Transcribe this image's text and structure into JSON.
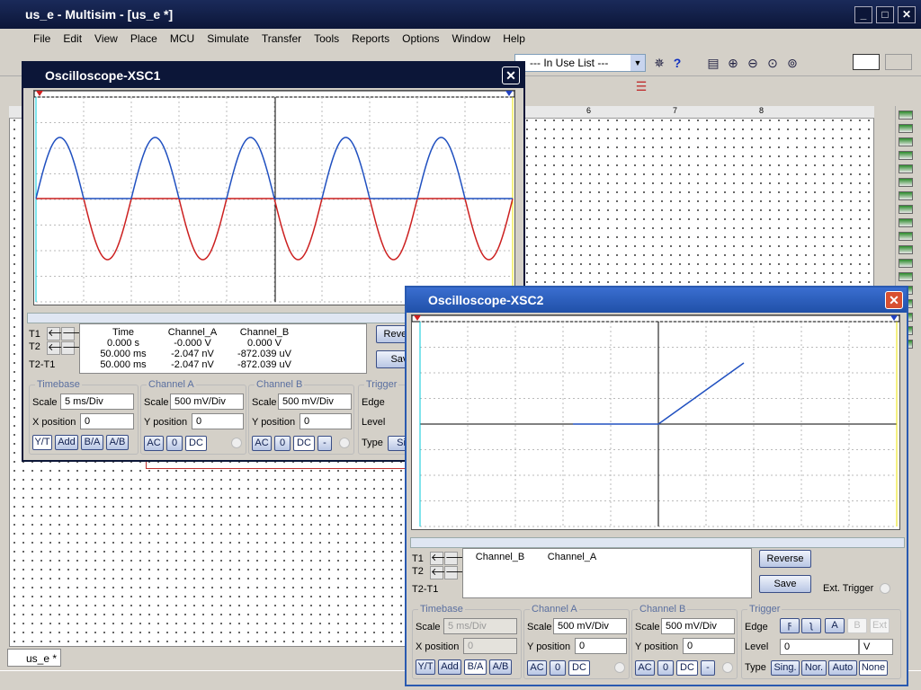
{
  "app": {
    "title": "us_e - Multisim - [us_e *]"
  },
  "menu": [
    "File",
    "Edit",
    "View",
    "Place",
    "MCU",
    "Simulate",
    "Transfer",
    "Tools",
    "Reports",
    "Options",
    "Window",
    "Help"
  ],
  "toolbar": {
    "in_use_list": "--- In Use List ---"
  },
  "ruler": [
    "6",
    "7",
    "8"
  ],
  "tab": {
    "label": "us_e *"
  },
  "colors": {
    "channel_a": "#cc2020",
    "channel_b": "#2050c0",
    "active_title": "#2a5ab0",
    "inactive_title": "#0c1638"
  },
  "xsc1": {
    "title": "Oscilloscope-XSC1",
    "readout": {
      "headers": [
        "Time",
        "Channel_A",
        "Channel_B"
      ],
      "rows": [
        {
          "label": "T1",
          "time": "0.000 s",
          "a": "-0.000 V",
          "b": "0.000 V"
        },
        {
          "label": "T2",
          "time": "50.000 ms",
          "a": "-2.047 nV",
          "b": "-872.039 uV"
        },
        {
          "label": "T2-T1",
          "time": "50.000 ms",
          "a": "-2.047 nV",
          "b": "-872.039 uV"
        }
      ]
    },
    "buttons": {
      "reverse": "Reverse",
      "save": "Save"
    },
    "timebase": {
      "title": "Timebase",
      "scale_label": "Scale",
      "scale": "5 ms/Div",
      "xpos_label": "X position",
      "xpos": "0",
      "modes": [
        "Y/T",
        "Add",
        "B/A",
        "A/B"
      ],
      "active_mode": "Y/T"
    },
    "channel_a": {
      "title": "Channel A",
      "scale_label": "Scale",
      "scale": "500 mV/Div",
      "ypos_label": "Y position",
      "ypos": "0",
      "coupling": [
        "AC",
        "0",
        "DC"
      ]
    },
    "channel_b": {
      "title": "Channel B",
      "scale_label": "Scale",
      "scale": "500 mV/Div",
      "ypos_label": "Y position",
      "ypos": "0",
      "coupling": [
        "AC",
        "0",
        "DC",
        "-"
      ]
    },
    "trigger": {
      "title": "Trigger",
      "edge_label": "Edge",
      "level_label": "Level",
      "type_label": "Type",
      "type_first": "Si"
    }
  },
  "xsc2": {
    "title": "Oscilloscope-XSC2",
    "readout": {
      "headers": [
        "Channel_B",
        "Channel_A"
      ],
      "row_labels": [
        "T1",
        "T2",
        "T2-T1"
      ]
    },
    "buttons": {
      "reverse": "Reverse",
      "save": "Save",
      "ext_trigger": "Ext. Trigger"
    },
    "timebase": {
      "title": "Timebase",
      "scale_label": "Scale",
      "scale": "5 ms/Div",
      "xpos_label": "X position",
      "xpos": "0",
      "modes": [
        "Y/T",
        "Add",
        "B/A",
        "A/B"
      ],
      "active_mode": "B/A"
    },
    "channel_a": {
      "title": "Channel A",
      "scale_label": "Scale",
      "scale": "500 mV/Div",
      "ypos_label": "Y position",
      "ypos": "0",
      "coupling": [
        "AC",
        "0",
        "DC"
      ]
    },
    "channel_b": {
      "title": "Channel B",
      "scale_label": "Scale",
      "scale": "500 mV/Div",
      "ypos_label": "Y position",
      "ypos": "0",
      "coupling": [
        "AC",
        "0",
        "DC",
        "-"
      ]
    },
    "trigger": {
      "title": "Trigger",
      "edge_label": "Edge",
      "level_label": "Level",
      "level": "0",
      "level_unit": "V",
      "type_label": "Type",
      "sources": [
        "A",
        "B",
        "Ext"
      ],
      "types": [
        "Sing.",
        "Nor.",
        "Auto",
        "None"
      ],
      "active_type": "None"
    }
  }
}
